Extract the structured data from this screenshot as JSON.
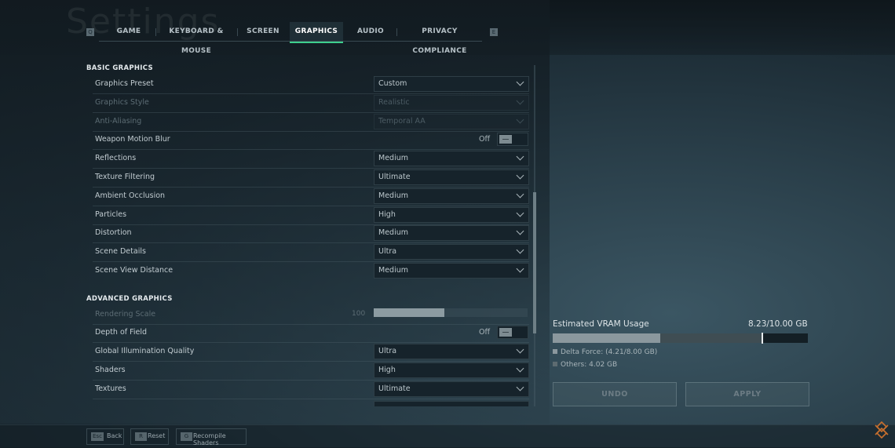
{
  "page": {
    "watermark_title": "Settings"
  },
  "tabs": {
    "left_key": "Q",
    "right_key": "E",
    "items": [
      {
        "label": "GAME",
        "active": false
      },
      {
        "label": "KEYBOARD & MOUSE",
        "active": false
      },
      {
        "label": "SCREEN",
        "active": false
      },
      {
        "label": "GRAPHICS",
        "active": true
      },
      {
        "label": "AUDIO",
        "active": false
      },
      {
        "label": "PRIVACY COMPLIANCE",
        "active": false
      }
    ]
  },
  "basic": {
    "title": "BASIC GRAPHICS",
    "rows": [
      {
        "label": "Graphics Preset",
        "type": "dropdown",
        "value": "Custom",
        "disabled": false
      },
      {
        "label": "Graphics Style",
        "type": "dropdown",
        "value": "Realistic",
        "disabled": true
      },
      {
        "label": "Anti-Aliasing",
        "type": "dropdown",
        "value": "Temporal AA",
        "disabled": true
      },
      {
        "label": "Weapon Motion Blur",
        "type": "toggle",
        "value": "Off",
        "disabled": false
      },
      {
        "label": "Reflections",
        "type": "dropdown",
        "value": "Medium",
        "disabled": false
      },
      {
        "label": "Texture Filtering",
        "type": "dropdown",
        "value": "Ultimate",
        "disabled": false
      },
      {
        "label": "Ambient Occlusion",
        "type": "dropdown",
        "value": "Medium",
        "disabled": false
      },
      {
        "label": "Particles",
        "type": "dropdown",
        "value": "High",
        "disabled": false
      },
      {
        "label": "Distortion",
        "type": "dropdown",
        "value": "Medium",
        "disabled": false
      },
      {
        "label": "Scene Details",
        "type": "dropdown",
        "value": "Ultra",
        "disabled": false
      },
      {
        "label": "Scene View Distance",
        "type": "dropdown",
        "value": "Medium",
        "disabled": false
      }
    ]
  },
  "advanced": {
    "title": "ADVANCED GRAPHICS",
    "rows": [
      {
        "label": "Rendering Scale",
        "type": "slider",
        "value": "100",
        "fraction": 0.46,
        "disabled": true
      },
      {
        "label": "Depth of Field",
        "type": "toggle",
        "value": "Off",
        "disabled": false
      },
      {
        "label": "Global Illumination Quality",
        "type": "dropdown",
        "value": "Ultra",
        "disabled": false
      },
      {
        "label": "Shaders",
        "type": "dropdown",
        "value": "High",
        "disabled": false
      },
      {
        "label": "Textures",
        "type": "dropdown",
        "value": "Ultimate",
        "disabled": false
      }
    ]
  },
  "vram": {
    "title": "Estimated VRAM Usage",
    "total_text": "8.23/10.00 GB",
    "game_fraction": 0.421,
    "total_fraction": 0.823,
    "limit_fraction": 0.8,
    "legend_game": "Delta Force: (4.21/8.00 GB)",
    "legend_others": "Others: 4.02 GB",
    "colors": {
      "game": "#8b989e",
      "others": "#3f4d53"
    }
  },
  "actions": {
    "undo": "UNDO",
    "apply": "APPLY"
  },
  "footer": [
    {
      "key": "Esc",
      "label": "Back"
    },
    {
      "key": "R",
      "label": "Reset"
    },
    {
      "key": "G",
      "label": "Recompile Shaders"
    }
  ],
  "accent": "#3ecf8e"
}
